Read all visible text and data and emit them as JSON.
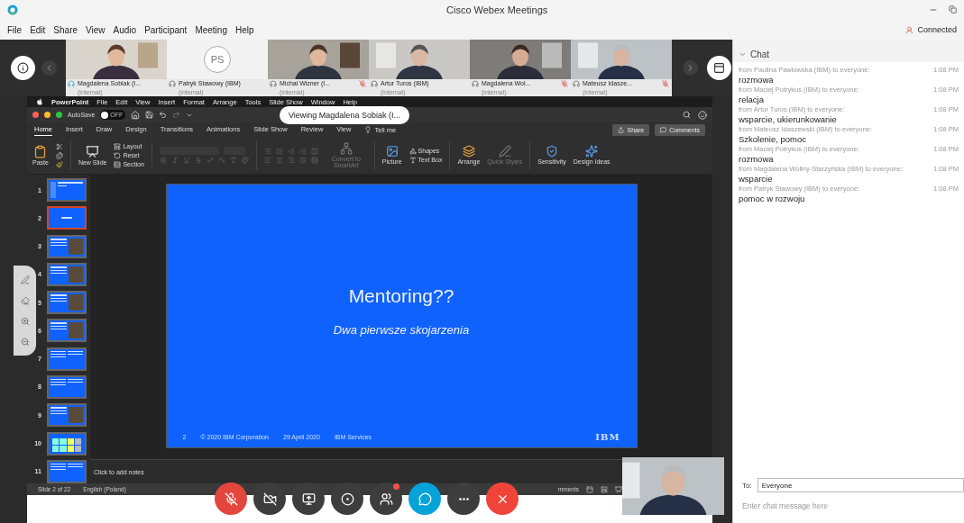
{
  "window": {
    "title": "Cisco Webex Meetings"
  },
  "menu": [
    "File",
    "Edit",
    "Share",
    "View",
    "Audio",
    "Participant",
    "Meeting",
    "Help"
  ],
  "connection": {
    "label": "Connected"
  },
  "participants": [
    {
      "name": "Magdalena Sobiak (I...",
      "tag": "(internal)",
      "kind": "video",
      "muted": false,
      "speaking": true
    },
    {
      "name": "Patryk Stawowy (IBM)",
      "tag": "(internal)",
      "kind": "avatar",
      "initials": "PS",
      "muted": false,
      "speaking": false
    },
    {
      "name": "Michał Wizner (I...",
      "tag": "(internal)",
      "kind": "video",
      "muted": true,
      "speaking": false
    },
    {
      "name": "Artur Turos (IBM)",
      "tag": "(internal)",
      "kind": "video",
      "muted": false,
      "speaking": false
    },
    {
      "name": "Magdalena Wol...",
      "tag": "(internal)",
      "kind": "video",
      "muted": true,
      "speaking": false
    },
    {
      "name": "Mateusz Idasze...",
      "tag": "(internal)",
      "kind": "video",
      "muted": true,
      "speaking": false
    }
  ],
  "shared_screen": {
    "viewing_label": "Viewing Magdalena Sobiak (I...",
    "mac_menu": [
      "PowerPoint",
      "File",
      "Edit",
      "View",
      "Insert",
      "Format",
      "Arrange",
      "Tools",
      "Slide Show",
      "Window",
      "Help"
    ],
    "autosave": {
      "label": "AutoSave",
      "state": "OFF",
      "on": false
    },
    "ribbon_tabs": [
      {
        "label": "Home",
        "selected": true
      },
      {
        "label": "Insert",
        "selected": false
      },
      {
        "label": "Draw",
        "selected": false
      },
      {
        "label": "Design",
        "selected": false
      },
      {
        "label": "Transitions",
        "selected": false
      },
      {
        "label": "Animations",
        "selected": false
      },
      {
        "label": "Slide Show",
        "selected": false
      },
      {
        "label": "Review",
        "selected": false
      },
      {
        "label": "View",
        "selected": false
      }
    ],
    "tell_me": "Tell me",
    "share_button": "Share",
    "comments_button": "Comments",
    "ribbon": {
      "paste": {
        "label": "Paste",
        "disabled": false
      },
      "new_slide": {
        "label": "New Slide",
        "disabled": false
      },
      "layout": {
        "label": "Layout",
        "disabled": false
      },
      "reset": {
        "label": "Reset",
        "disabled": false
      },
      "section": {
        "label": "Section",
        "disabled": false
      },
      "smartart": {
        "label": "Convert to SmartArt",
        "disabled": true
      },
      "picture": {
        "label": "Picture",
        "disabled": false
      },
      "shapes": {
        "label": "Shapes",
        "disabled": false
      },
      "text_box": {
        "label": "Text Box",
        "disabled": false
      },
      "arrange": {
        "label": "Arrange",
        "disabled": false
      },
      "quick_styles": {
        "label": "Quick Styles",
        "disabled": true
      },
      "sensitivity": {
        "label": "Sensitivity",
        "disabled": false
      },
      "design_ideas": {
        "label": "Design Ideas",
        "disabled": false
      }
    },
    "thumbnails": [
      {
        "number": "1",
        "kind": "title",
        "selected": false
      },
      {
        "number": "2",
        "kind": "plain",
        "selected": true
      },
      {
        "number": "3",
        "selected": false
      },
      {
        "number": "4",
        "selected": false
      },
      {
        "number": "5",
        "selected": false
      },
      {
        "number": "6",
        "selected": false
      },
      {
        "number": "7",
        "kind": "text",
        "selected": false
      },
      {
        "number": "8",
        "kind": "text",
        "selected": false
      },
      {
        "number": "9",
        "selected": false
      },
      {
        "number": "10",
        "kind": "grid",
        "selected": false
      },
      {
        "number": "11",
        "kind": "text",
        "selected": false
      }
    ],
    "slide": {
      "title": "Mentoring??",
      "subtitle": "Dwa pierwsze skojarzenia",
      "footer": [
        "2",
        "© 2020 IBM Corporation",
        "29 April 2020",
        "IBM Services"
      ],
      "logo": "IBM"
    },
    "notes_placeholder": "Click to add notes",
    "status": {
      "slide": "Slide 2 of 22",
      "language": "English (Poland)",
      "comments": "mments"
    }
  },
  "controls": [
    {
      "kind": "mute",
      "active": true,
      "badge": false
    },
    {
      "kind": "video",
      "active": false,
      "badge": false
    },
    {
      "kind": "share",
      "active": false,
      "badge": false
    },
    {
      "kind": "record",
      "active": false,
      "badge": false
    },
    {
      "kind": "participants",
      "active": false,
      "badge": true
    },
    {
      "kind": "chat",
      "active": true,
      "badge": false
    },
    {
      "kind": "more",
      "active": false,
      "badge": false
    },
    {
      "kind": "leave",
      "active": true,
      "badge": false
    }
  ],
  "chat": {
    "title": "Chat",
    "expanded": true,
    "messages": [
      {
        "from": "from Paulina Pawłowska (IBM) to everyone:",
        "time": "1:08 PM",
        "text": "rozmowa"
      },
      {
        "from": "from Maciej Potrykus (IBM) to everyone:",
        "time": "1:08 PM",
        "text": "relacja"
      },
      {
        "from": "from Artur Turos (IBM) to everyone:",
        "time": "1:08 PM",
        "text": "wsparcie, ukierunkowanie"
      },
      {
        "from": "from Mateusz Idaszewski (IBM) to everyone:",
        "time": "1:08 PM",
        "text": "Szkolenie, pomoc"
      },
      {
        "from": "from Maciej Potrykus (IBM) to everyone:",
        "time": "1:08 PM",
        "text": "rozmowa"
      },
      {
        "from": "from Magdalena Wollny-Starzyńska (IBM) to everyone:",
        "time": "1:08 PM",
        "text": "wsparcie"
      },
      {
        "from": "from Patryk Stawowy (IBM) to everyone:",
        "time": "1:08 PM",
        "text": "pomoc w rozwoju"
      }
    ],
    "to_label": "To:",
    "recipient": "Everyone",
    "placeholder": "Enter chat message here"
  }
}
